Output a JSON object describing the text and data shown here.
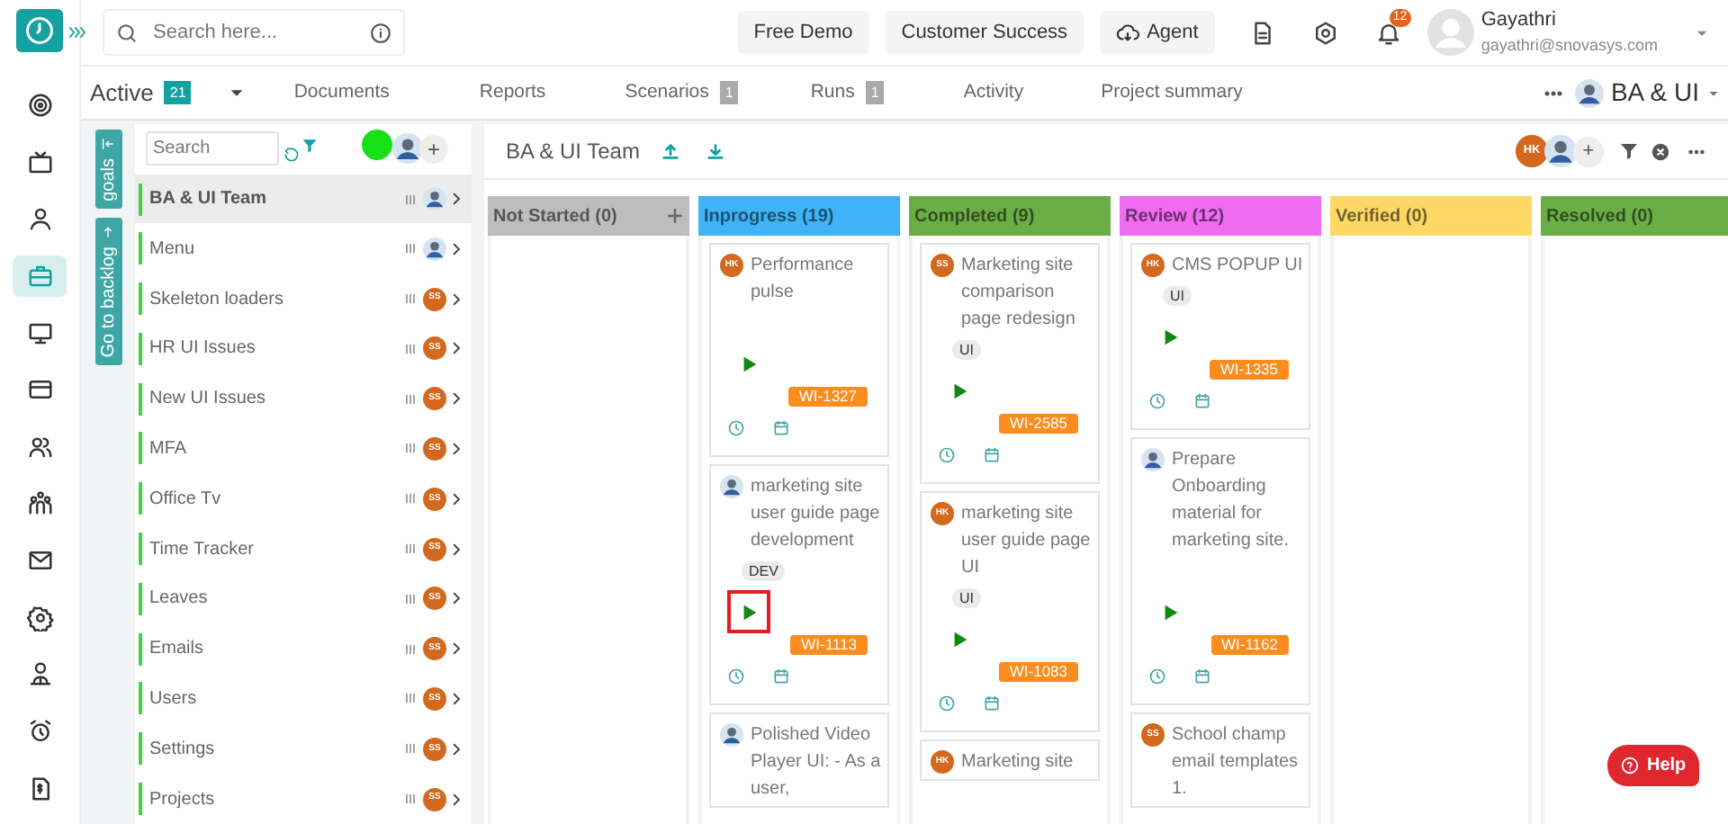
{
  "header": {
    "search": {
      "placeholder": "Search here..."
    },
    "buttons": [
      {
        "label": "Free Demo",
        "kind": "plain"
      },
      {
        "label": "Customer Success",
        "kind": "plain"
      },
      {
        "label": "Agent",
        "kind": "cloud"
      }
    ],
    "notifications": "12",
    "user": {
      "name": "Gayathri",
      "email": "gayathri@snovasys.com"
    }
  },
  "nav_items": [
    {
      "selected": false
    },
    {
      "selected": false
    },
    {
      "selected": false
    },
    {
      "selected": true
    },
    {
      "selected": false
    },
    {
      "selected": false
    },
    {
      "selected": false
    },
    {
      "selected": false
    },
    {
      "selected": false
    },
    {
      "selected": false
    },
    {
      "selected": false
    },
    {
      "selected": false
    },
    {
      "selected": false
    }
  ],
  "tabs": [
    {
      "label": "Active",
      "count": "21",
      "kind": "dropdown"
    },
    {
      "label": "Documents",
      "kind": "link"
    },
    {
      "label": "Reports",
      "kind": "link"
    },
    {
      "label": "Scenarios",
      "count": "1",
      "kind": "link"
    },
    {
      "label": "Runs",
      "count": "1",
      "kind": "link"
    },
    {
      "label": "Activity",
      "kind": "link"
    },
    {
      "label": "Project summary",
      "kind": "link"
    }
  ],
  "project_selector": {
    "label": "BA & UI"
  },
  "side_tabs": [
    {
      "label": "goals"
    },
    {
      "label": "Go to backlog"
    }
  ],
  "goal_list": {
    "search": {
      "placeholder": "Search"
    },
    "add_button": "+",
    "items": [
      {
        "name": "BA & UI Team",
        "selected": true,
        "avatar": {
          "kind": "photo"
        }
      },
      {
        "name": "Menu",
        "selected": false,
        "avatar": {
          "kind": "photo"
        }
      },
      {
        "name": "Skeleton loaders",
        "selected": false,
        "avatar": {
          "kind": "initials",
          "initials": "SS"
        }
      },
      {
        "name": "HR UI Issues",
        "selected": false,
        "avatar": {
          "kind": "initials",
          "initials": "SS"
        }
      },
      {
        "name": "New UI Issues",
        "selected": false,
        "avatar": {
          "kind": "initials",
          "initials": "SS"
        }
      },
      {
        "name": "MFA",
        "selected": false,
        "avatar": {
          "kind": "initials",
          "initials": "SS"
        }
      },
      {
        "name": "Office Tv",
        "selected": false,
        "avatar": {
          "kind": "initials",
          "initials": "SS"
        }
      },
      {
        "name": "Time Tracker",
        "selected": false,
        "avatar": {
          "kind": "initials",
          "initials": "SS"
        }
      },
      {
        "name": "Leaves",
        "selected": false,
        "avatar": {
          "kind": "initials",
          "initials": "SS"
        }
      },
      {
        "name": "Emails",
        "selected": false,
        "avatar": {
          "kind": "initials",
          "initials": "SS"
        }
      },
      {
        "name": "Users",
        "selected": false,
        "avatar": {
          "kind": "initials",
          "initials": "SS"
        }
      },
      {
        "name": "Settings",
        "selected": false,
        "avatar": {
          "kind": "initials",
          "initials": "SS"
        }
      },
      {
        "name": "Projects",
        "selected": false,
        "avatar": {
          "kind": "initials",
          "initials": "SS"
        }
      }
    ]
  },
  "board": {
    "title": "BA & UI Team",
    "members": [
      {
        "kind": "initials",
        "initials": "HK"
      },
      {
        "kind": "photo"
      }
    ],
    "add_button": "+",
    "columns": [
      {
        "name": "Not Started (0)",
        "color": "#bdbdbd",
        "can_add": true
      },
      {
        "name": "Inprogress (19)",
        "color": "#3fb3f5",
        "can_add": false,
        "cards": [
          {
            "avatar": {
              "kind": "initials",
              "initials": "HK"
            },
            "title": "Performance pulse",
            "id": "WI-1327",
            "highlighted": false
          },
          {
            "avatar": {
              "kind": "photo"
            },
            "title": "marketing site user guide page development",
            "tag": "DEV",
            "id": "WI-1113",
            "highlighted": true
          },
          {
            "avatar": {
              "kind": "photo"
            },
            "title": "Polished Video Player UI: - As a user,"
          }
        ]
      },
      {
        "name": "Completed (9)",
        "color": "#6cae46",
        "can_add": false,
        "cards": [
          {
            "avatar": {
              "kind": "initials",
              "initials": "SS"
            },
            "title": "Marketing site comparison page redesign",
            "tag": "UI",
            "id": "WI-2585",
            "highlighted": false
          },
          {
            "avatar": {
              "kind": "initials",
              "initials": "HK"
            },
            "title": "marketing site user guide page UI",
            "tag": "UI",
            "id": "WI-1083",
            "highlighted": false
          },
          {
            "avatar": {
              "kind": "initials",
              "initials": "HK"
            },
            "title": "Marketing site"
          }
        ]
      },
      {
        "name": "Review (12)",
        "color": "#ef6bef",
        "can_add": false,
        "cards": [
          {
            "avatar": {
              "kind": "initials",
              "initials": "HK"
            },
            "title": "CMS POPUP UI",
            "tag": "UI",
            "id": "WI-1335",
            "highlighted": false
          },
          {
            "avatar": {
              "kind": "photo"
            },
            "title": "Prepare Onboarding material for marketing site.",
            "id": "WI-1162",
            "highlighted": false
          },
          {
            "avatar": {
              "kind": "initials",
              "initials": "SS"
            },
            "title": "School champ email templates 1."
          }
        ]
      },
      {
        "name": "Verified (0)",
        "color": "#fdd865",
        "can_add": false
      },
      {
        "name": "Resolved (0)",
        "color": "#6cae46",
        "can_add": false
      }
    ]
  },
  "help": {
    "label": "Help"
  }
}
